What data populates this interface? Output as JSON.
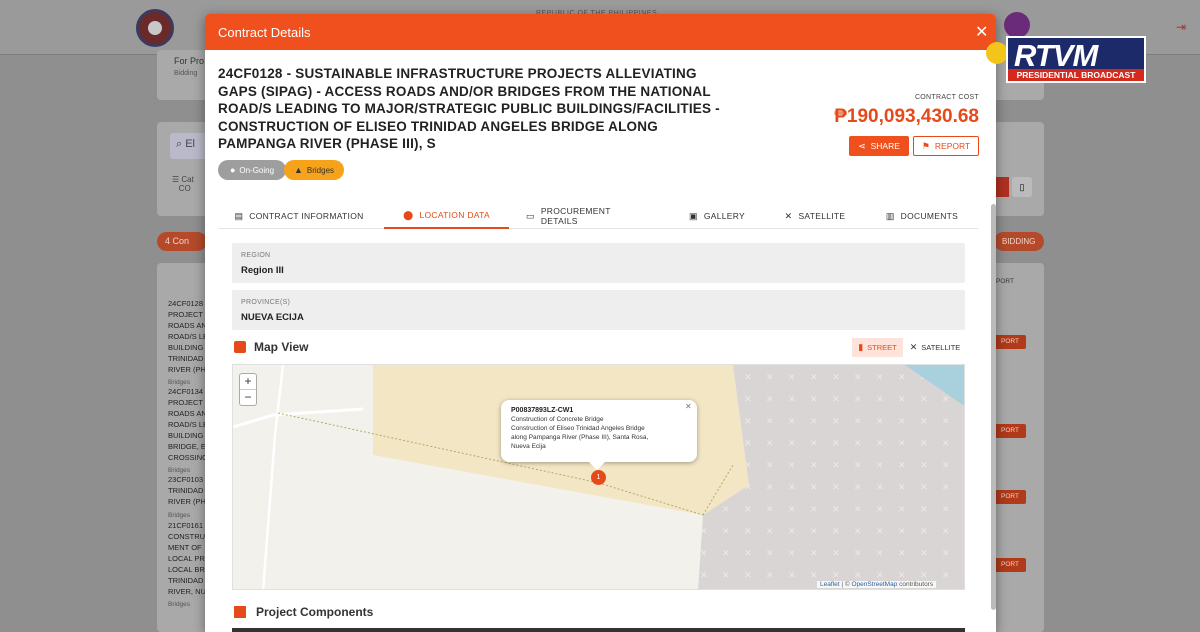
{
  "background": {
    "republic_text": "REPUBLIC OF THE PHILIPPINES",
    "for_pro_label": "For Pro",
    "bidding_small": "Bidding",
    "search_fragment": "El",
    "filter_label": "Cat",
    "filter_sub": "CO",
    "count_pill": "4 Con",
    "bidding_pill": "BIDDING",
    "report_col_label": "PORT",
    "report_btn_label": "PORT",
    "list_text_1": "24CF0128\nPROJECT\nROADS AN\nROAD/S LE\nBUILDING\nTRINIDAD\nRIVER (PH",
    "list_text_1_cat": "Bridges",
    "list_text_2": "24CF0134\nPROJECT\nROADS AN\nROAD/S LE\nBUILDING\nBRIDGE, E\nCROSSING",
    "list_text_2_cat": "Bridges",
    "list_text_3": "23CF0103\nTRINIDAD\nRIVER (PH",
    "list_text_3_cat": "Bridges",
    "list_text_4": "21CF0161\nCONSTRUCT\nMENT OF\nLOCAL PR\nLOCAL BR\nTRINIDAD\nRIVER, NU",
    "list_text_4_cat": "Bridges"
  },
  "watermark": {
    "brand": "RTVM",
    "subtitle": "PRESIDENTIAL BROADCAST"
  },
  "modal": {
    "header_title": "Contract Details",
    "close_glyph": "✕",
    "project_title": "24CF0128 - SUSTAINABLE INFRASTRUCTURE PROJECTS ALLEVIATING GAPS (SIPAG) - ACCESS ROADS AND/OR BRIDGES FROM THE NATIONAL ROAD/S LEADING TO MAJOR/STRATEGIC PUBLIC BUILDINGS/FACILITIES - CONSTRUCTION OF ELISEO TRINIDAD ANGELES BRIDGE ALONG PAMPANGA RIVER (PHASE III), S",
    "contract_cost_label": "CONTRACT COST",
    "contract_cost_value": "₱190,093,430.68",
    "share_label": "SHARE",
    "report_label": "REPORT",
    "status_badge": "On-Going",
    "category_badge": "Bridges",
    "accent_color": "#f0501e",
    "tabs": [
      {
        "label": "CONTRACT INFORMATION",
        "icon": "document-icon"
      },
      {
        "label": "LOCATION DATA",
        "icon": "location-pin-icon"
      },
      {
        "label": "PROCUREMENT DETAILS",
        "icon": "folder-icon"
      },
      {
        "label": "GALLERY",
        "icon": "image-icon"
      },
      {
        "label": "SATELLITE",
        "icon": "satellite-icon"
      },
      {
        "label": "DOCUMENTS",
        "icon": "documents-icon"
      }
    ],
    "active_tab": "LOCATION DATA",
    "region": {
      "label": "REGION",
      "value": "Region III"
    },
    "province": {
      "label": "PROVINCE(S)",
      "value": "NUEVA ECIJA"
    },
    "map_view_title": "Map View",
    "map_street_label": "STREET",
    "map_satellite_label": "SATELLITE",
    "map_popup": {
      "id": "P00837893LZ-CW1",
      "line1": "Construction of Concrete Bridge",
      "line2": "Construction of Eliseo Trinidad Angeles Bridge",
      "line3": "along Pampanga River (Phase III), Santa Rosa,",
      "line4": "Nueva Ecija"
    },
    "marker_count": "1",
    "attribution_leaflet": "Leaflet",
    "attribution_osm": "OpenStreetMap",
    "attribution_suffix": "contributors",
    "project_components_title": "Project Components"
  }
}
